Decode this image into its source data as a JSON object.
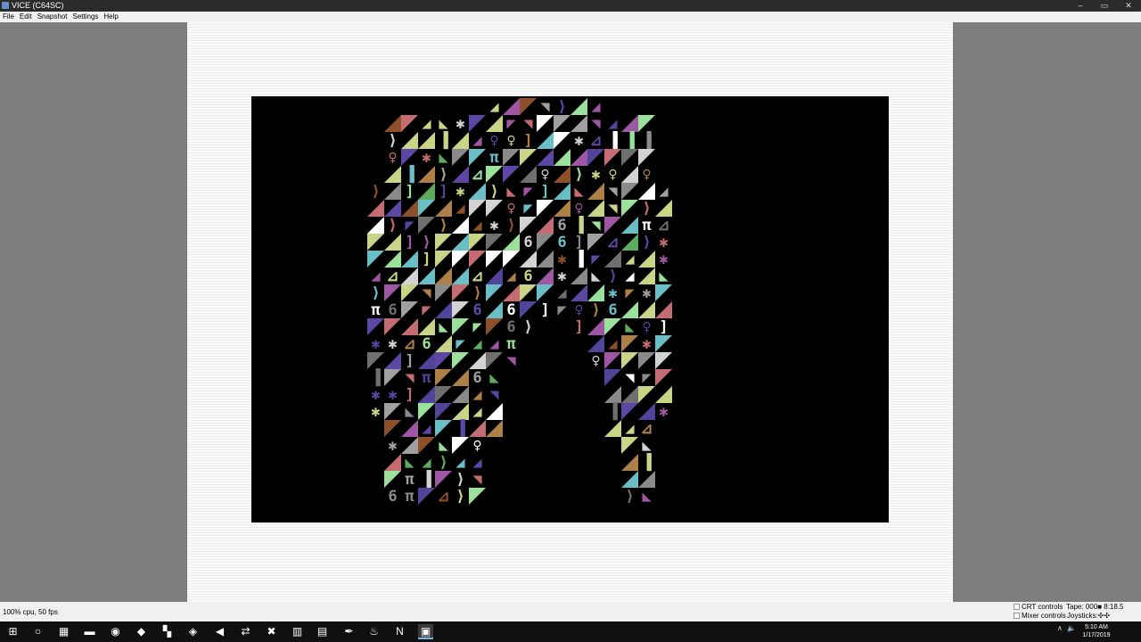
{
  "window": {
    "title": "VICE (C64SC)",
    "controls": {
      "minimize": "–",
      "maximize": "▭",
      "close": "✕"
    }
  },
  "menu": [
    "File",
    "Edit",
    "Snapshot",
    "Settings",
    "Help"
  ],
  "c64_screen": {
    "background": "#000000",
    "palette": [
      "#6abfc6",
      "#9ae29b",
      "#c46c71",
      "#a057a3",
      "#5c47a5",
      "#ffffff",
      "#d3d3d3",
      "#c9d487",
      "#8e5029",
      "#6f6f6f",
      "#5cab5e",
      "#ae7f47",
      "#50459b",
      "#8a8a8a",
      "#a0a0a0",
      "#c9d487"
    ],
    "glyphs": [
      "⊿",
      "◢",
      "◣",
      "◤",
      "◥",
      "▐",
      "]",
      "⟩",
      "✱",
      "π",
      "♀",
      "6"
    ]
  },
  "status": {
    "performance": "100% cpu, 50 fps",
    "crt_controls": "CRT controls",
    "mixer_controls": "Mixer controls",
    "tape_label": "Tape:",
    "tape_counter": "000",
    "tape_time": "8:18.5",
    "joysticks_label": "Joysticks:",
    "joysticks_icon": "✣✣"
  },
  "taskbar": {
    "apps": [
      {
        "name": "start",
        "icon": "windows-icon",
        "glyph": "⊞"
      },
      {
        "name": "search",
        "icon": "search-icon",
        "glyph": "○"
      },
      {
        "name": "calculator",
        "icon": "calculator-icon",
        "glyph": "▦"
      },
      {
        "name": "file-explorer",
        "icon": "folder-icon",
        "glyph": "▬"
      },
      {
        "name": "chrome",
        "icon": "chrome-icon",
        "glyph": "◉"
      },
      {
        "name": "visual-studio",
        "icon": "visual-studio-icon",
        "glyph": "◆"
      },
      {
        "name": "colorful-app",
        "icon": "tiles-icon",
        "glyph": "▚"
      },
      {
        "name": "virtualbox",
        "icon": "cube-icon",
        "glyph": "◈"
      },
      {
        "name": "winamp",
        "icon": "lightning-icon",
        "glyph": "◀"
      },
      {
        "name": "teamviewer",
        "icon": "teamviewer-icon",
        "glyph": "⇄"
      },
      {
        "name": "tool",
        "icon": "crossed-tool-icon",
        "glyph": "✖"
      },
      {
        "name": "server",
        "icon": "server-icon",
        "glyph": "▥"
      },
      {
        "name": "notepad",
        "icon": "notepad-icon",
        "glyph": "▤"
      },
      {
        "name": "feather",
        "icon": "feather-icon",
        "glyph": "✒"
      },
      {
        "name": "steam",
        "icon": "steam-icon",
        "glyph": "♨"
      },
      {
        "name": "editor",
        "icon": "n-app-icon",
        "glyph": "N"
      },
      {
        "name": "vice",
        "icon": "vice-icon",
        "glyph": "▣"
      }
    ],
    "tray": {
      "chevron": "∧",
      "speaker": "🔈",
      "time": "5:10 AM",
      "date": "1/17/2019"
    }
  }
}
